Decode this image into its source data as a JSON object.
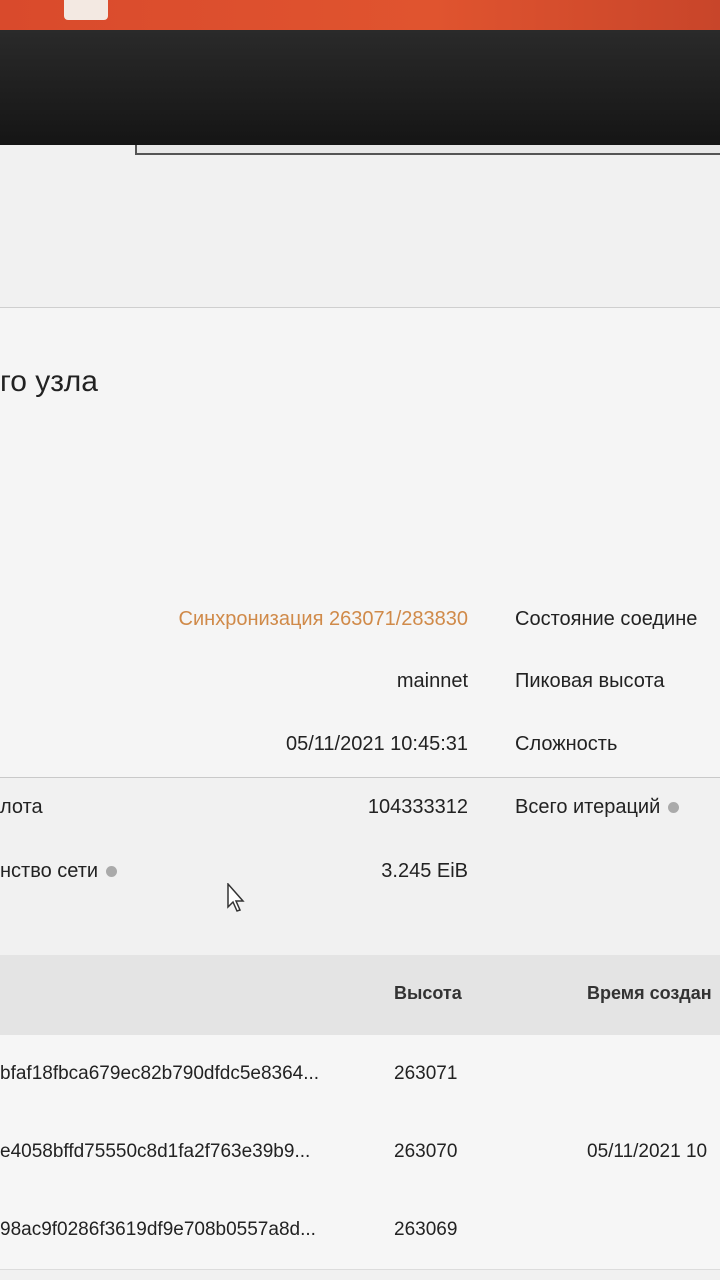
{
  "panel": {
    "title": "го узла",
    "sync_status": "Синхронизация 263071/283830",
    "network": "mainnet",
    "timestamp": "05/11/2021 10:45:31",
    "slot_label": "лота",
    "slot_value": "104333312",
    "space_label": "нство сети",
    "space_value": "3.245 EiB",
    "connection_label": "Состояние соедине",
    "peak_height_label": "Пиковая высота",
    "difficulty_label": "Сложность",
    "iterations_label": "Всего итераций"
  },
  "table": {
    "headers": {
      "height": "Высота",
      "time": "Время создан"
    },
    "rows": [
      {
        "hash": "bfaf18fbca679ec82b790dfdc5e8364...",
        "height": "263071",
        "time": ""
      },
      {
        "hash": "e4058bffd75550c8d1fa2f763e39b9...",
        "height": "263070",
        "time": "05/11/2021 10"
      },
      {
        "hash": "98ac9f0286f3619df9e708b0557a8d...",
        "height": "263069",
        "time": ""
      }
    ]
  },
  "colors": {
    "sync": "#d08a49",
    "bezel": "#e0542f"
  }
}
